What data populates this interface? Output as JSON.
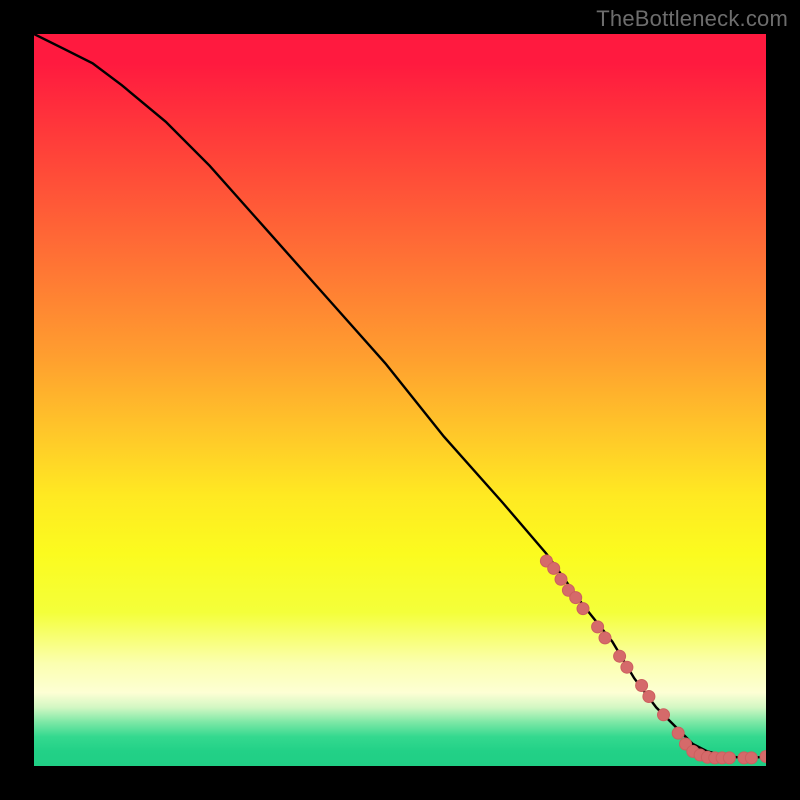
{
  "watermark": "TheBottleneck.com",
  "palette": {
    "curve_stroke": "#000000",
    "marker_fill": "#d56a6a",
    "marker_stroke": "#cc5f5f",
    "bg": "#000000"
  },
  "chart_data": {
    "type": "line",
    "title": "",
    "xlabel": "",
    "ylabel": "",
    "xlim": [
      0,
      100
    ],
    "ylim": [
      0,
      100
    ],
    "grid": false,
    "legend": false,
    "series": [
      {
        "name": "bottleneck-curve",
        "x": [
          0,
          4,
          8,
          12,
          18,
          24,
          32,
          40,
          48,
          56,
          64,
          70,
          75,
          79,
          82,
          85,
          88,
          90,
          92,
          94,
          96,
          98,
          100
        ],
        "y": [
          100,
          98,
          96,
          93,
          88,
          82,
          73,
          64,
          55,
          45,
          36,
          29,
          22,
          17,
          12,
          8,
          5,
          3,
          2,
          1.5,
          1.2,
          1.1,
          1.3
        ]
      }
    ],
    "markers": [
      {
        "x": 70,
        "y": 28
      },
      {
        "x": 71,
        "y": 27
      },
      {
        "x": 72,
        "y": 25.5
      },
      {
        "x": 73,
        "y": 24
      },
      {
        "x": 74,
        "y": 23
      },
      {
        "x": 75,
        "y": 21.5
      },
      {
        "x": 77,
        "y": 19
      },
      {
        "x": 78,
        "y": 17.5
      },
      {
        "x": 80,
        "y": 15
      },
      {
        "x": 81,
        "y": 13.5
      },
      {
        "x": 83,
        "y": 11
      },
      {
        "x": 84,
        "y": 9.5
      },
      {
        "x": 86,
        "y": 7
      },
      {
        "x": 88,
        "y": 4.5
      },
      {
        "x": 89,
        "y": 3
      },
      {
        "x": 90,
        "y": 2
      },
      {
        "x": 91,
        "y": 1.5
      },
      {
        "x": 92,
        "y": 1.2
      },
      {
        "x": 93,
        "y": 1.1
      },
      {
        "x": 94,
        "y": 1.1
      },
      {
        "x": 95,
        "y": 1.1
      },
      {
        "x": 97,
        "y": 1.1
      },
      {
        "x": 98,
        "y": 1.1
      },
      {
        "x": 100,
        "y": 1.3
      }
    ]
  }
}
